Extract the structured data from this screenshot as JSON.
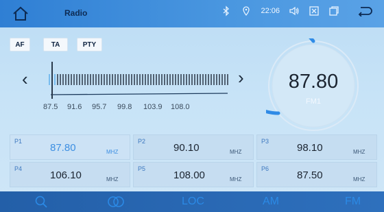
{
  "header": {
    "title": "Radio",
    "time": "22:06"
  },
  "options": {
    "af": "AF",
    "ta": "TA",
    "pty": "PTY"
  },
  "tuner": {
    "frequency": "87.80",
    "band": "FM1",
    "scale_labels": [
      "87.5",
      "91.6",
      "95.7",
      "99.8",
      "103.9",
      "108.0"
    ]
  },
  "presets": [
    {
      "num": "P1",
      "freq": "87.80",
      "unit": "MHZ",
      "active": true
    },
    {
      "num": "P2",
      "freq": "90.10",
      "unit": "MHZ",
      "active": false
    },
    {
      "num": "P3",
      "freq": "98.10",
      "unit": "MHZ",
      "active": false
    },
    {
      "num": "P4",
      "freq": "106.10",
      "unit": "MHZ",
      "active": false
    },
    {
      "num": "P5",
      "freq": "108.00",
      "unit": "MHZ",
      "active": false
    },
    {
      "num": "P6",
      "freq": "87.50",
      "unit": "MHZ",
      "active": false
    }
  ],
  "bottom_bar": {
    "loc": "LOC",
    "am": "AM",
    "fm": "FM"
  },
  "icons": {
    "home": "home-icon",
    "bluetooth": "bluetooth-icon",
    "location": "location-pin-icon",
    "volume": "volume-icon",
    "close": "close-box-icon",
    "window": "window-icon",
    "back": "back-arrow-icon",
    "search": "search-icon",
    "stereo": "stereo-icon"
  },
  "colors": {
    "accent": "#3d8fe2",
    "topbar": "#2f7fd4",
    "bottombar": "#235fa8"
  }
}
